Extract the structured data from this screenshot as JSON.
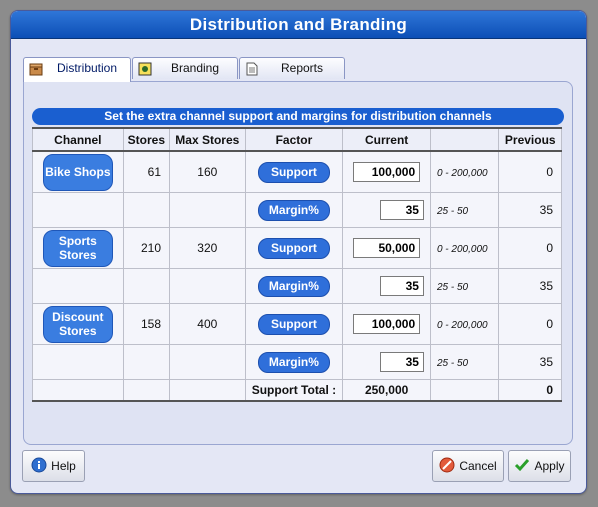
{
  "dialog": {
    "title": "Distribution and Branding"
  },
  "tabs": [
    {
      "label": "Distribution",
      "icon": "box-icon",
      "active": true
    },
    {
      "label": "Branding",
      "icon": "image-icon",
      "active": false
    },
    {
      "label": "Reports",
      "icon": "document-icon",
      "active": false
    }
  ],
  "banner": "Set the extra channel support and margins for distribution channels",
  "columns": {
    "channel": "Channel",
    "stores": "Stores",
    "max_stores": "Max Stores",
    "factor": "Factor",
    "current": "Current",
    "range": "",
    "previous": "Previous"
  },
  "channels": [
    {
      "name": "Bike Shops",
      "stores": "61",
      "max_stores": "160",
      "support": {
        "label": "Support",
        "value": "100,000",
        "range": "0 - 200,000",
        "previous": "0"
      },
      "margin": {
        "label": "Margin%",
        "value": "35",
        "range": "25 - 50",
        "previous": "35"
      }
    },
    {
      "name": "Sports Stores",
      "stores": "210",
      "max_stores": "320",
      "support": {
        "label": "Support",
        "value": "50,000",
        "range": "0 - 200,000",
        "previous": "0"
      },
      "margin": {
        "label": "Margin%",
        "value": "35",
        "range": "25 - 50",
        "previous": "35"
      }
    },
    {
      "name": "Discount Stores",
      "stores": "158",
      "max_stores": "400",
      "support": {
        "label": "Support",
        "value": "100,000",
        "range": "0 - 200,000",
        "previous": "0"
      },
      "margin": {
        "label": "Margin%",
        "value": "35",
        "range": "25 - 50",
        "previous": "35"
      }
    }
  ],
  "total": {
    "label": "Support Total :",
    "current": "250,000",
    "previous": "0"
  },
  "buttons": {
    "help": "Help",
    "cancel": "Cancel",
    "apply": "Apply"
  },
  "colors": {
    "title_bar": "#1a5fd0",
    "accent_button": "#3a7de0",
    "dialog_bg": "#e4e7f5",
    "outer_bg": "#8c8c8c"
  }
}
